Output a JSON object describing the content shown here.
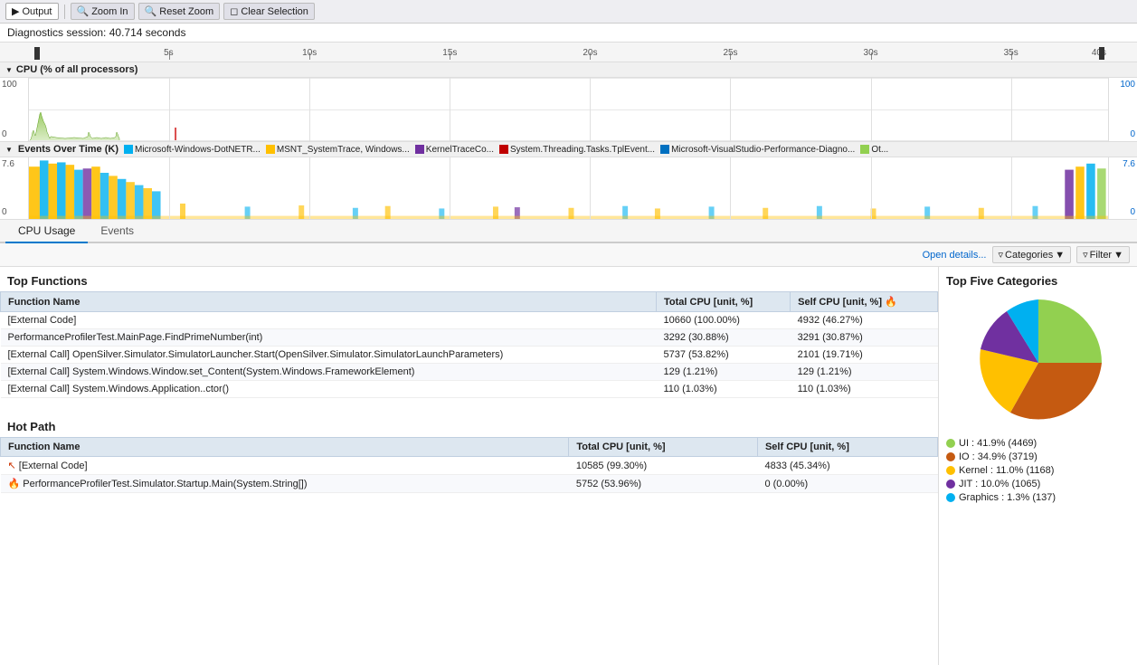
{
  "toolbar": {
    "output_label": "Output",
    "zoom_in_label": "Zoom In",
    "reset_zoom_label": "Reset Zoom",
    "clear_selection_label": "Clear Selection"
  },
  "diag_header": {
    "text": "Diagnostics session: 40.714 seconds"
  },
  "ruler": {
    "ticks": [
      "5s",
      "10s",
      "15s",
      "20s",
      "25s",
      "30s",
      "35s",
      "40s"
    ],
    "tick_positions": [
      13,
      26,
      39,
      52,
      65,
      78,
      91,
      97
    ]
  },
  "cpu_chart": {
    "header": "CPU (% of all processors)",
    "y_top": "100",
    "y_bottom": "0",
    "y_right_top": "100",
    "y_right_bottom": "0"
  },
  "events_chart": {
    "header": "Events Over Time (K)",
    "y_top": "7.6",
    "y_bottom": "0",
    "y_right_top": "7.6",
    "y_right_bottom": "0",
    "legend": [
      {
        "color": "#00b0f0",
        "label": "Microsoft-Windows-DotNETR..."
      },
      {
        "color": "#ffc000",
        "label": "MSNT_SystemTrace, Windows..."
      },
      {
        "color": "#7030a0",
        "label": "KernelTraceCo..."
      },
      {
        "color": "#c00000",
        "label": "System.Threading.Tasks.TplEvent..."
      },
      {
        "color": "#0070c0",
        "label": "Microsoft-VisualStudio-Performance-Diagno..."
      },
      {
        "color": "#92d050",
        "label": "Ot..."
      }
    ]
  },
  "tabs": [
    {
      "label": "CPU Usage",
      "active": true
    },
    {
      "label": "Events",
      "active": false
    }
  ],
  "action_bar": {
    "open_details_label": "Open details...",
    "categories_label": "Categories",
    "filter_label": "Filter"
  },
  "top_functions": {
    "title": "Top Functions",
    "columns": [
      "Function Name",
      "Total CPU [unit, %]",
      "Self CPU [unit, %]"
    ],
    "rows": [
      {
        "name": "[External Code]",
        "total_cpu": "10660 (100.00%)",
        "self_cpu": "4932 (46.27%)",
        "is_link": true,
        "hot": false
      },
      {
        "name": "PerformanceProfilerTest.MainPage.FindPrimeNumber(int)",
        "total_cpu": "3292 (30.88%)",
        "self_cpu": "3291 (30.87%)",
        "is_link": true,
        "hot": false
      },
      {
        "name": "[External Call] OpenSilver.Simulator.SimulatorLauncher.Start(OpenSilver.Simulator.SimulatorLaunchParameters)",
        "total_cpu": "5737 (53.82%)",
        "self_cpu": "2101 (19.71%)",
        "is_link": true,
        "hot": false
      },
      {
        "name": "[External Call] System.Windows.Window.set_Content(System.Windows.FrameworkElement)",
        "total_cpu": "129 (1.21%)",
        "self_cpu": "129 (1.21%)",
        "is_link": true,
        "hot": false
      },
      {
        "name": "[External Call] System.Windows.Application..ctor()",
        "total_cpu": "110 (1.03%)",
        "self_cpu": "110 (1.03%)",
        "is_link": true,
        "hot": false
      }
    ]
  },
  "hot_path": {
    "title": "Hot Path",
    "columns": [
      "Function Name",
      "Total CPU [unit, %]",
      "Self CPU [unit, %]"
    ],
    "rows": [
      {
        "name": "[External Code]",
        "total_cpu": "10585 (99.30%)",
        "self_cpu": "4833 (45.34%)",
        "is_link": true,
        "back_arrow": true,
        "hot": false
      },
      {
        "name": "PerformanceProfilerTest.Simulator.Startup.Main(System.String[])",
        "total_cpu": "5752 (53.96%)",
        "self_cpu": "0 (0.00%)",
        "is_link": true,
        "back_arrow": false,
        "hot": true
      }
    ]
  },
  "top_five_categories": {
    "title": "Top Five Categories",
    "segments": [
      {
        "label": "UI",
        "percent": 41.9,
        "count": 4469,
        "color": "#92d050",
        "start_angle": 0
      },
      {
        "label": "IO",
        "percent": 34.9,
        "count": 3719,
        "color": "#c55a11",
        "start_angle": 0
      },
      {
        "label": "Kernel",
        "percent": 11.0,
        "count": 1168,
        "color": "#ffc000",
        "start_angle": 0
      },
      {
        "label": "JIT",
        "percent": 10.0,
        "count": 1065,
        "color": "#7030a0",
        "start_angle": 0
      },
      {
        "label": "Graphics",
        "percent": 1.3,
        "count": 137,
        "color": "#00b0f0",
        "start_angle": 0
      }
    ],
    "legend": [
      {
        "color": "#92d050",
        "label": "UI : 41.9% (4469)"
      },
      {
        "color": "#c55a11",
        "label": "IO : 34.9% (3719)"
      },
      {
        "color": "#ffc000",
        "label": "Kernel : 11.0% (1168)"
      },
      {
        "color": "#7030a0",
        "label": "JIT : 10.0% (1065)"
      },
      {
        "color": "#00b0f0",
        "label": "Graphics : 1.3% (137)"
      }
    ]
  }
}
